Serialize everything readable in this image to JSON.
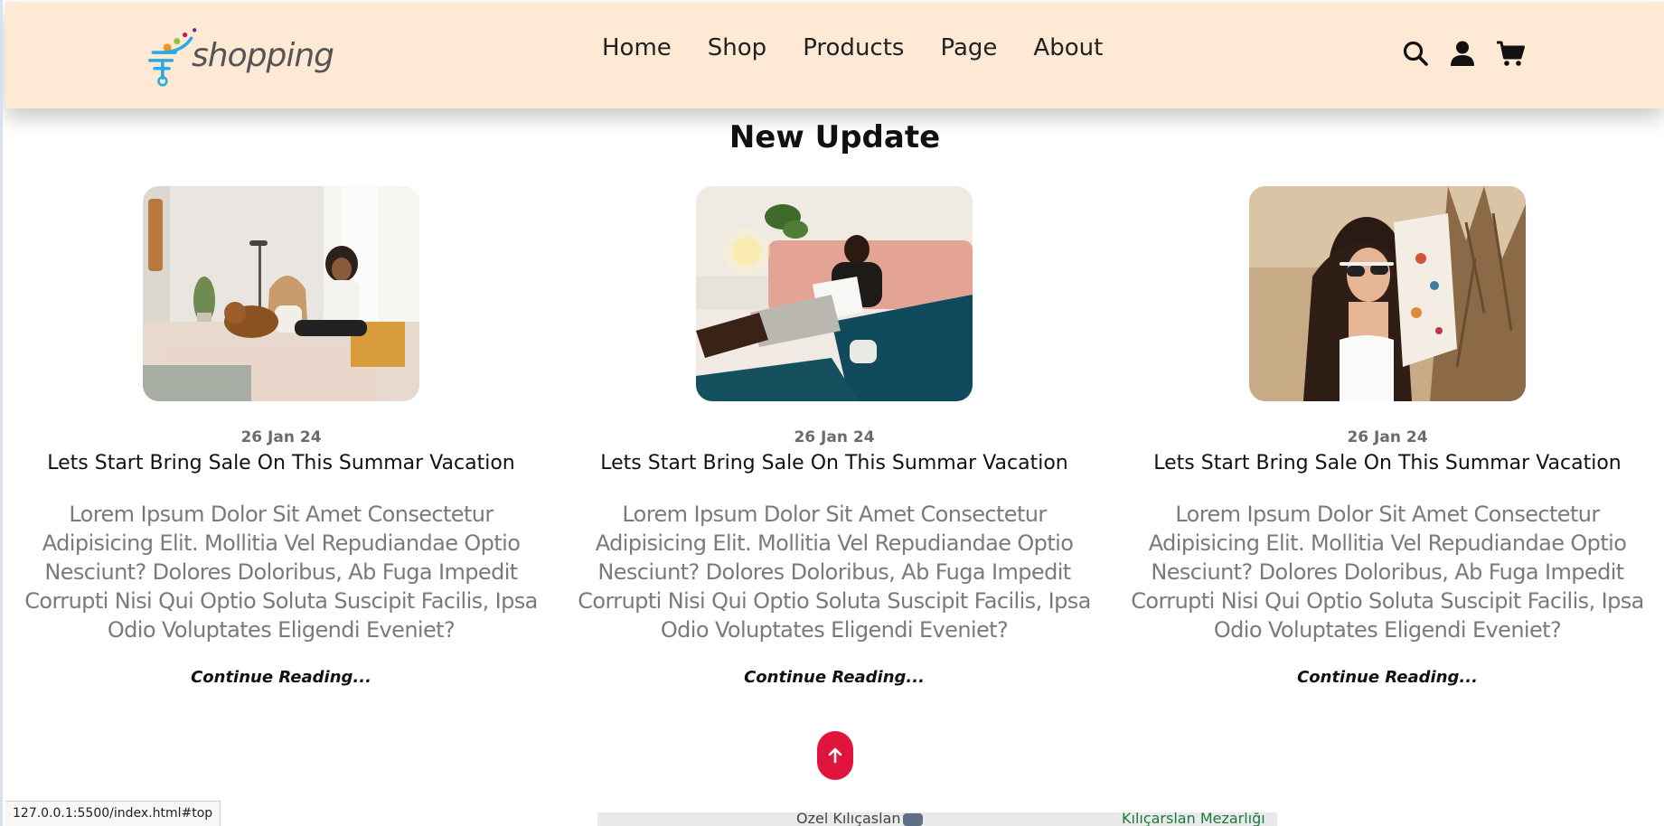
{
  "brand": {
    "name": "shopping"
  },
  "nav": {
    "items": [
      {
        "label": "Home"
      },
      {
        "label": "Shop"
      },
      {
        "label": "Products"
      },
      {
        "label": "Page"
      },
      {
        "label": "About"
      }
    ]
  },
  "header_icons": [
    "search-icon",
    "user-icon",
    "cart-icon"
  ],
  "section": {
    "title": "New Update"
  },
  "posts": [
    {
      "date": "26 Jan 24",
      "title": "Lets Start Bring Sale On This Summar Vacation",
      "excerpt": "Lorem Ipsum Dolor Sit Amet Consectetur Adipisicing Elit. Mollitia Vel Repudiandae Optio Nesciunt? Dolores Doloribus, Ab Fuga Impedit Corrupti Nisi Qui Optio Soluta Suscipit Facilis, Ipsa Odio Voluptates Eligendi Eveniet?",
      "link": "Continue Reading..."
    },
    {
      "date": "26 Jan 24",
      "title": "Lets Start Bring Sale On This Summar Vacation",
      "excerpt": "Lorem Ipsum Dolor Sit Amet Consectetur Adipisicing Elit. Mollitia Vel Repudiandae Optio Nesciunt? Dolores Doloribus, Ab Fuga Impedit Corrupti Nisi Qui Optio Soluta Suscipit Facilis, Ipsa Odio Voluptates Eligendi Eveniet?",
      "link": "Continue Reading..."
    },
    {
      "date": "26 Jan 24",
      "title": "Lets Start Bring Sale On This Summar Vacation",
      "excerpt": "Lorem Ipsum Dolor Sit Amet Consectetur Adipisicing Elit. Mollitia Vel Repudiandae Optio Nesciunt? Dolores Doloribus, Ab Fuga Impedit Corrupti Nisi Qui Optio Soluta Suscipit Facilis, Ipsa Odio Voluptates Eligendi Eveniet?",
      "link": "Continue Reading..."
    }
  ],
  "map": {
    "labels": [
      "Özel Kılıçaslan",
      "Kılıçarslan Mezarlığı"
    ]
  },
  "status_bar": {
    "url": "127.0.0.1:5500/index.html#top"
  },
  "colors": {
    "header_bg": "#fde9d4",
    "accent": "#e0143c",
    "text_muted": "#7a7a7a"
  }
}
